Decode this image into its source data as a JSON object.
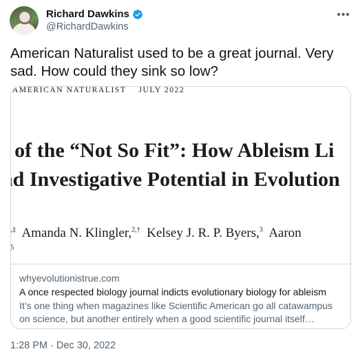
{
  "author": {
    "display_name": "Richard Dawkins",
    "handle": "@RichardDawkins",
    "avatar_icon": "profile-photo",
    "verified_icon": "verified-badge-icon",
    "verified_color": "#1d9bf0"
  },
  "tweet": {
    "text": "American Naturalist used to be a great journal. Very sad. How could they sink so low?",
    "timestamp": "1:28 PM · Dec 30, 2022"
  },
  "card": {
    "image": {
      "journal": "AMERICAN NATURALIST",
      "issue_date": "JULY 2022",
      "title_line_1": "s of the “Not So Fit”: How Ableism Li",
      "title_line_2": "nd Investigative Potential in Evolution",
      "authors_line_1_prefix": ",†,‡",
      "author_1": "Amanda N. Klingler,",
      "author_1_sup": "2,†",
      "author_2": "Kelsey J. R. P. Byers,",
      "author_2_sup": "3",
      "author_3": "Aaron",
      "authors_line_2": "s",
      "authors_line_2_sup": "5"
    },
    "domain": "whyevolutionistrue.com",
    "title": "A once respected biology journal indicts evolutionary biology for ableism",
    "description": "It’s one thing when magazines like Scientific American go all catawampus on science, but another entirely when a good scientific journal itself succumbs to the “progressive” Left’s diminution of science."
  },
  "more_icon": "more-horizontal-icon",
  "colors": {
    "text_primary": "#0f1419",
    "text_secondary": "#536471",
    "border": "#cfd9de"
  }
}
